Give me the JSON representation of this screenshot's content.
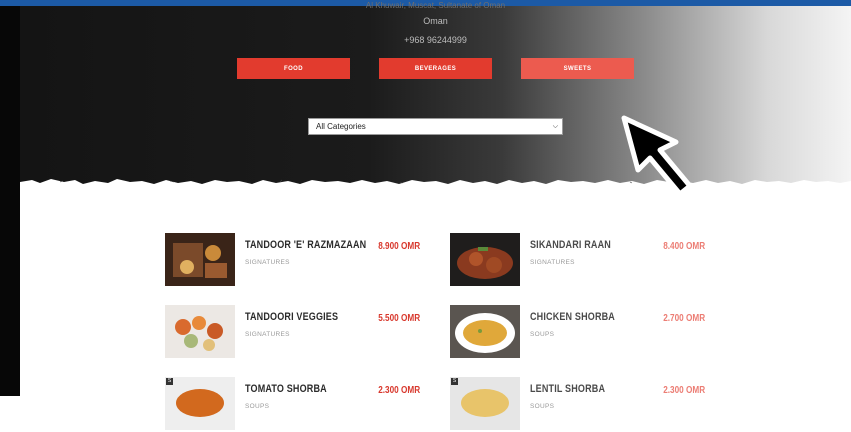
{
  "header": {
    "address_faint": "Al Khuwair, Muscat, Sultanate of Oman",
    "country": "Oman",
    "phone": "+968 96244999"
  },
  "categories": {
    "food": "FOOD",
    "beverages": "BEVERAGES",
    "sweets": "SWEETS"
  },
  "filter": {
    "selected": "All Categories"
  },
  "menu": [
    {
      "name": "TANDOOR 'E' RAZMAZAAN",
      "category": "SIGNATURES",
      "price": "8.900 OMR"
    },
    {
      "name": "SIKANDARI RAAN",
      "category": "SIGNATURES",
      "price": "8.400 OMR"
    },
    {
      "name": "TANDOORI VEGGIES",
      "category": "SIGNATURES",
      "price": "5.500 OMR"
    },
    {
      "name": "CHICKEN SHORBA",
      "category": "SOUPS",
      "price": "2.700 OMR"
    },
    {
      "name": "TOMATO SHORBA",
      "category": "SOUPS",
      "price": "2.300 OMR"
    },
    {
      "name": "LENTIL SHORBA",
      "category": "SOUPS",
      "price": "2.300 OMR"
    }
  ],
  "colors": {
    "accent": "#e23b2e",
    "price": "#d8382d",
    "topbar": "#1c5aa6"
  }
}
